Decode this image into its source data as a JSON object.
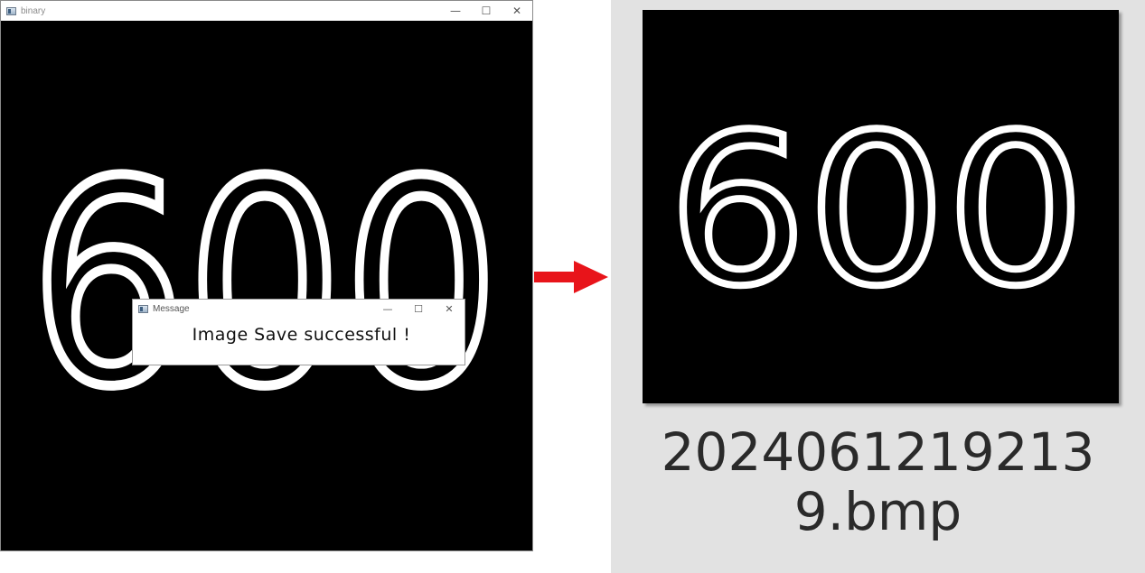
{
  "binary_window": {
    "title": "binary",
    "image_text": "600",
    "controls": {
      "minimize": "—",
      "maximize": "☐",
      "close": "✕"
    }
  },
  "message_dialog": {
    "title": "Message",
    "text": "Image Save successful !",
    "controls": {
      "minimize": "—",
      "maximize": "☐",
      "close": "✕"
    }
  },
  "arrow": {
    "color": "#e8141a",
    "icon": "right-arrow-icon"
  },
  "file_thumbnail": {
    "image_text": "600",
    "filename_line1": "2024061219213",
    "filename_line2": "9.bmp"
  }
}
